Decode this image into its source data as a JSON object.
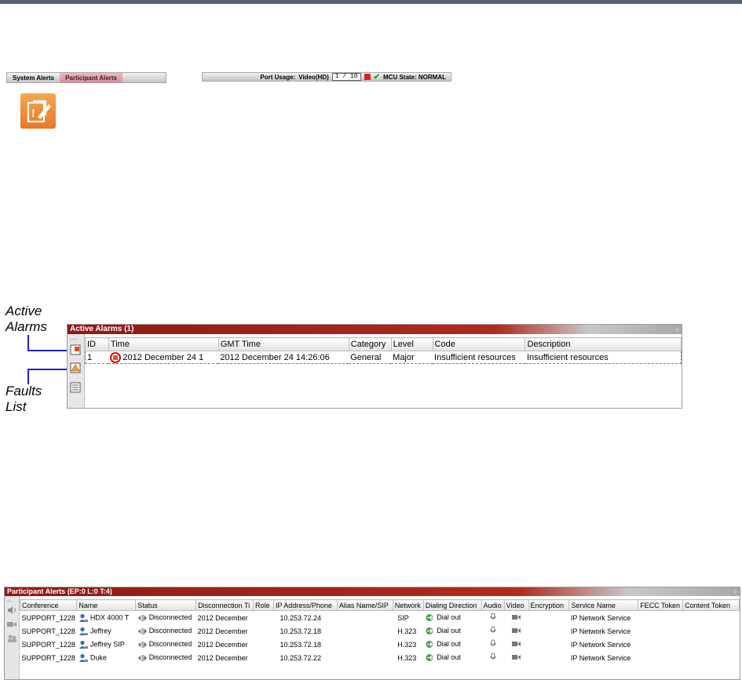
{
  "status_bar": {
    "tabs": [
      "System Alerts",
      "Participant Alerts"
    ],
    "port_usage_label": "Port Usage:",
    "video_label": "Video(HD)",
    "port_value": "1 / 10",
    "mcu_state": "MCU State: NORMAL"
  },
  "callouts": {
    "active_alarms_line1": "Active",
    "active_alarms_line2": "Alarms",
    "faults_list_line1": "Faults",
    "faults_list_line2": "List"
  },
  "active_alarms": {
    "title": "Active Alarms (1)",
    "columns": [
      "ID",
      "Time",
      "GMT Time",
      "Category",
      "Level",
      "Code",
      "Description"
    ],
    "rows": [
      {
        "id": "1",
        "time": "2012 December 24 1",
        "gmt_time": "2012 December 24 14:26:06",
        "category": "General",
        "level": "Major",
        "code": "Insufficient resources",
        "description": "Insufficient resources"
      }
    ]
  },
  "participant_alerts": {
    "title": "Participant Alerts (EP:0 L:0 T:4)",
    "columns": [
      "Conference",
      "Name",
      "Status",
      "Disconnection Ti",
      "Role",
      "IP Address/Phone",
      "Alias Name/SIP",
      "Network",
      "Dialing Direction",
      "Audio",
      "Video",
      "Encryption",
      "Service Name",
      "FECC Token",
      "Content Token"
    ],
    "rows": [
      {
        "conference": "SUPPORT_1228",
        "name": "HDX 4000 T",
        "status": "Disconnected",
        "disc_time": "2012 December",
        "role": "",
        "ip": "10.253.72.24",
        "alias": "",
        "network": "SIP",
        "dialing": "Dial out",
        "encryption": "",
        "service": "IP Network Service",
        "fecc": "",
        "content": ""
      },
      {
        "conference": "SUPPORT_1228",
        "name": "Jeffrey",
        "status": "Disconnected",
        "disc_time": "2012 December",
        "role": "",
        "ip": "10.253.72.18",
        "alias": "",
        "network": "H.323",
        "dialing": "Dial out",
        "encryption": "",
        "service": "IP Network Service",
        "fecc": "",
        "content": ""
      },
      {
        "conference": "SUPPORT_1228",
        "name": "Jeffrey SIP",
        "status": "Disconnected",
        "disc_time": "2012 December",
        "role": "",
        "ip": "10.253.72.18",
        "alias": "",
        "network": "H.323",
        "dialing": "Dial out",
        "encryption": "",
        "service": "IP Network Service",
        "fecc": "",
        "content": ""
      },
      {
        "conference": "SUPPORT_1228",
        "name": "Duke",
        "status": "Disconnected",
        "disc_time": "2012 December",
        "role": "",
        "ip": "10.253.72.22",
        "alias": "",
        "network": "H.323",
        "dialing": "Dial out",
        "encryption": "",
        "service": "IP Network Service",
        "fecc": "",
        "content": ""
      }
    ]
  },
  "colors": {
    "panel_title": "#9e2219",
    "active_tab": "#e99aa6",
    "note_icon": "#ec8232",
    "callout_line": "#2222cc"
  }
}
